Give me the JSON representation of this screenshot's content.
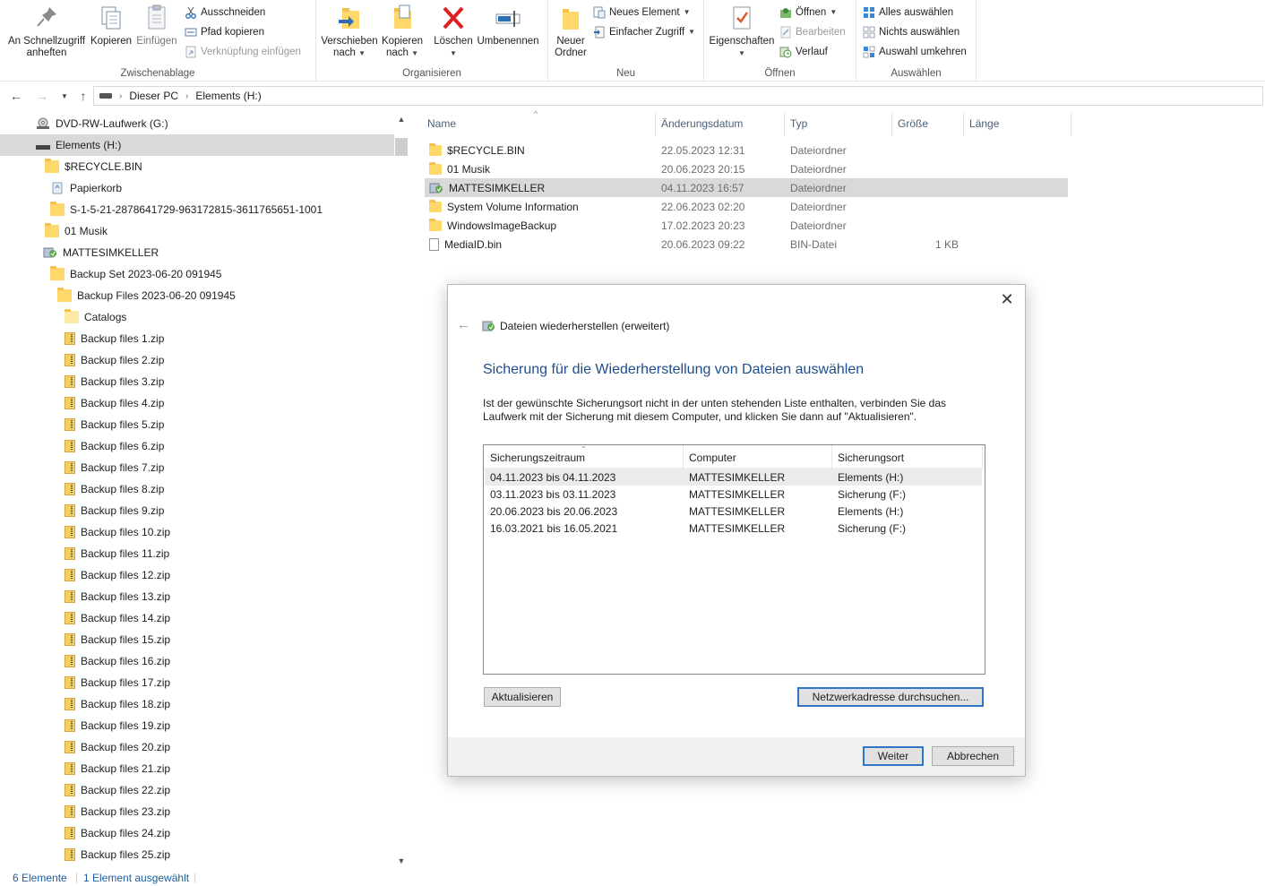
{
  "ribbon": {
    "clipboard": {
      "pin_label": "An Schnellzugriff anheften",
      "copy_label": "Kopieren",
      "paste_label": "Einfügen",
      "cut_label": "Ausschneiden",
      "copy_path_label": "Pfad kopieren",
      "paste_shortcut_label": "Verknüpfung einfügen",
      "group_label": "Zwischenablage"
    },
    "organize": {
      "move_to_label": "Verschieben nach",
      "copy_to_label": "Kopieren nach",
      "delete_label": "Löschen",
      "rename_label": "Umbenennen",
      "group_label": "Organisieren"
    },
    "new": {
      "new_folder_label": "Neuer Ordner",
      "new_item_label": "Neues Element",
      "easy_access_label": "Einfacher Zugriff",
      "group_label": "Neu"
    },
    "open": {
      "properties_label": "Eigenschaften",
      "open_label": "Öffnen",
      "edit_label": "Bearbeiten",
      "history_label": "Verlauf",
      "group_label": "Öffnen"
    },
    "select": {
      "select_all_label": "Alles auswählen",
      "select_none_label": "Nichts auswählen",
      "invert_label": "Auswahl umkehren",
      "group_label": "Auswählen"
    }
  },
  "address": {
    "crumbs": [
      "Dieser PC",
      "Elements (H:)"
    ]
  },
  "tree": {
    "items": [
      {
        "label": "DVD-RW-Laufwerk (G:)",
        "icon": "dvd-drive-icon"
      },
      {
        "label": "Elements (H:)",
        "icon": "drive-icon",
        "selected": true
      },
      {
        "label": "$RECYCLE.BIN",
        "icon": "folder-icon"
      },
      {
        "label": "Papierkorb",
        "icon": "recycle-bin-icon"
      },
      {
        "label": "S-1-5-21-2878641729-963172815-3611765651-1001",
        "icon": "folder-icon"
      },
      {
        "label": "01 Musik",
        "icon": "folder-icon"
      },
      {
        "label": "MATTESIMKELLER",
        "icon": "backup-icon"
      },
      {
        "label": "Backup Set 2023-06-20 091945",
        "icon": "folder-icon"
      },
      {
        "label": "Backup Files 2023-06-20 091945",
        "icon": "folder-icon"
      },
      {
        "label": "Catalogs",
        "icon": "folder-icon"
      },
      {
        "label": "Backup files 1.zip",
        "icon": "zip-icon"
      },
      {
        "label": "Backup files 2.zip",
        "icon": "zip-icon"
      },
      {
        "label": "Backup files 3.zip",
        "icon": "zip-icon"
      },
      {
        "label": "Backup files 4.zip",
        "icon": "zip-icon"
      },
      {
        "label": "Backup files 5.zip",
        "icon": "zip-icon"
      },
      {
        "label": "Backup files 6.zip",
        "icon": "zip-icon"
      },
      {
        "label": "Backup files 7.zip",
        "icon": "zip-icon"
      },
      {
        "label": "Backup files 8.zip",
        "icon": "zip-icon"
      },
      {
        "label": "Backup files 9.zip",
        "icon": "zip-icon"
      },
      {
        "label": "Backup files 10.zip",
        "icon": "zip-icon"
      },
      {
        "label": "Backup files 11.zip",
        "icon": "zip-icon"
      },
      {
        "label": "Backup files 12.zip",
        "icon": "zip-icon"
      },
      {
        "label": "Backup files 13.zip",
        "icon": "zip-icon"
      },
      {
        "label": "Backup files 14.zip",
        "icon": "zip-icon"
      },
      {
        "label": "Backup files 15.zip",
        "icon": "zip-icon"
      },
      {
        "label": "Backup files 16.zip",
        "icon": "zip-icon"
      },
      {
        "label": "Backup files 17.zip",
        "icon": "zip-icon"
      },
      {
        "label": "Backup files 18.zip",
        "icon": "zip-icon"
      },
      {
        "label": "Backup files 19.zip",
        "icon": "zip-icon"
      },
      {
        "label": "Backup files 20.zip",
        "icon": "zip-icon"
      },
      {
        "label": "Backup files 21.zip",
        "icon": "zip-icon"
      },
      {
        "label": "Backup files 22.zip",
        "icon": "zip-icon"
      },
      {
        "label": "Backup files 23.zip",
        "icon": "zip-icon"
      },
      {
        "label": "Backup files 24.zip",
        "icon": "zip-icon"
      },
      {
        "label": "Backup files 25.zip",
        "icon": "zip-icon"
      }
    ]
  },
  "files": {
    "columns": [
      "Name",
      "Änderungsdatum",
      "Typ",
      "Größe",
      "Länge"
    ],
    "rows": [
      {
        "name": "$RECYCLE.BIN",
        "date": "22.05.2023 12:31",
        "type": "Dateiordner",
        "size": "",
        "icon": "folder-icon"
      },
      {
        "name": "01 Musik",
        "date": "20.06.2023 20:15",
        "type": "Dateiordner",
        "size": "",
        "icon": "folder-icon"
      },
      {
        "name": "MATTESIMKELLER",
        "date": "04.11.2023 16:57",
        "type": "Dateiordner",
        "size": "",
        "icon": "backup-icon",
        "selected": true
      },
      {
        "name": "System Volume Information",
        "date": "22.06.2023 02:20",
        "type": "Dateiordner",
        "size": "",
        "icon": "folder-icon"
      },
      {
        "name": "WindowsImageBackup",
        "date": "17.02.2023 20:23",
        "type": "Dateiordner",
        "size": "",
        "icon": "folder-icon"
      },
      {
        "name": "MediaID.bin",
        "date": "20.06.2023 09:22",
        "type": "BIN-Datei",
        "size": "1 KB",
        "icon": "file-icon"
      }
    ]
  },
  "status": {
    "count": "6 Elemente",
    "selection": "1 Element ausgewählt"
  },
  "dialog": {
    "title": "Dateien wiederherstellen (erweitert)",
    "heading": "Sicherung für die Wiederherstellung von Dateien auswählen",
    "description": "Ist der gewünschte Sicherungsort nicht in der unten stehenden Liste enthalten, verbinden Sie das Laufwerk mit der Sicherung mit diesem Computer, und klicken Sie dann auf \"Aktualisieren\".",
    "table": {
      "headers": [
        "Sicherungszeitraum",
        "Computer",
        "Sicherungsort"
      ],
      "rows": [
        {
          "period": "04.11.2023 bis 04.11.2023",
          "computer": "MATTESIMKELLER",
          "location": "Elements (H:)",
          "selected": true
        },
        {
          "period": "03.11.2023 bis 03.11.2023",
          "computer": "MATTESIMKELLER",
          "location": "Sicherung (F:)"
        },
        {
          "period": "20.06.2023 bis 20.06.2023",
          "computer": "MATTESIMKELLER",
          "location": "Elements (H:)"
        },
        {
          "period": "16.03.2021 bis 16.05.2021",
          "computer": "MATTESIMKELLER",
          "location": "Sicherung (F:)"
        }
      ]
    },
    "refresh_label": "Aktualisieren",
    "browse_label": "Netzwerkadresse durchsuchen...",
    "next_label": "Weiter",
    "cancel_label": "Abbrechen"
  },
  "colors": {
    "accent": "#1e4e8c",
    "selection": "#d9d9d9",
    "folder": "#ffd86b",
    "default_button_border": "#2f76c5"
  }
}
